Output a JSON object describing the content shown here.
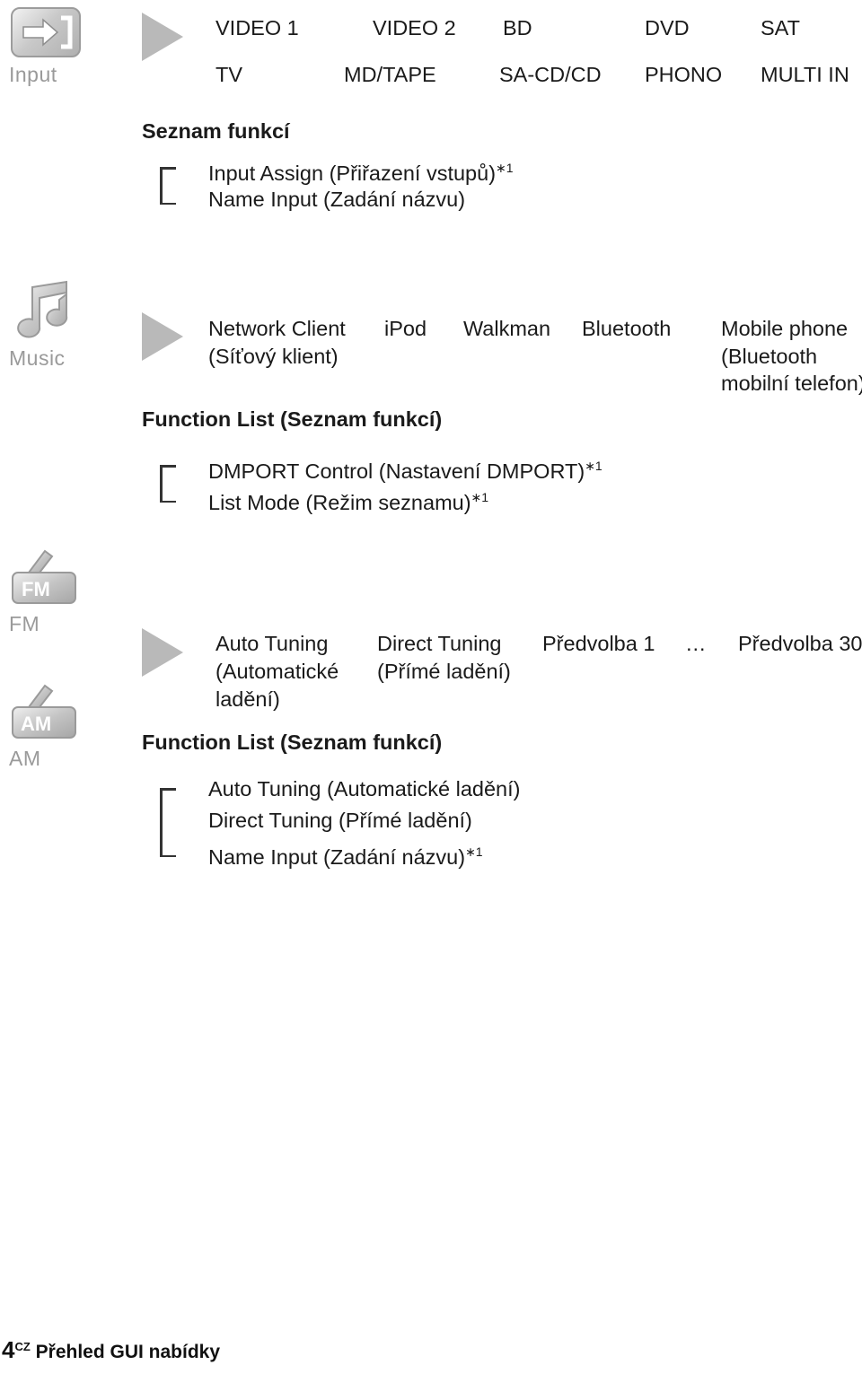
{
  "page": {
    "footer_page": "4",
    "footer_sup": "CZ",
    "footer_text": " Přehled GUI nabídky"
  },
  "sections": [
    {
      "icon_name": "input-icon",
      "icon_label": "Input",
      "sources_row1": [
        "VIDEO 1",
        "VIDEO 2",
        "BD",
        "DVD",
        "SAT"
      ],
      "sources_row2": [
        "TV",
        "MD/TAPE",
        "SA-CD/CD",
        "PHONO",
        "MULTI IN"
      ],
      "list_title": "Seznam funkcí",
      "list_items": [
        {
          "text": "Input Assign (Přiřazení vstupů)",
          "sup": "∗1"
        },
        {
          "text": "Name Input (Zadání názvu)",
          "sup": ""
        }
      ]
    },
    {
      "icon_name": "music-icon",
      "icon_label": "Music",
      "sources_row1": [
        "Network Client",
        "iPod",
        "Walkman",
        "Bluetooth",
        "Mobile phone"
      ],
      "sources_row1_sub": [
        "(Síťový klient)",
        "",
        "",
        "",
        "(Bluetooth"
      ],
      "sources_row1_sub2": [
        "",
        "",
        "",
        "",
        "mobilní telefon)"
      ],
      "list_title": "Function List (Seznam funkcí)",
      "list_items": [
        {
          "text": "DMPORT Control (Nastavení DMPORT)",
          "sup": "∗1"
        },
        {
          "text": "List Mode (Režim seznamu)",
          "sup": "∗1"
        }
      ]
    },
    {
      "icon_name": "fm-am-icon",
      "icon_label_fm": "FM",
      "icon_label_am": "AM",
      "icon_badge_fm": "FM",
      "icon_badge_am": "AM",
      "sources_row1": [
        "Auto Tuning",
        "Direct Tuning",
        "Předvolba 1",
        "…",
        "Předvolba 30"
      ],
      "sources_row1_sub": [
        "(Automatické",
        "(Přímé ladění)",
        "",
        "",
        ""
      ],
      "sources_row1_sub2": [
        "ladění)",
        "",
        "",
        "",
        ""
      ],
      "list_title": "Function List (Seznam funkcí)",
      "list_items": [
        {
          "text": "Auto Tuning (Automatické ladění)",
          "sup": ""
        },
        {
          "text": "Direct Tuning (Přímé ladění)",
          "sup": ""
        },
        {
          "text": "Name Input (Zadání názvu)",
          "sup": "∗1"
        }
      ]
    }
  ]
}
